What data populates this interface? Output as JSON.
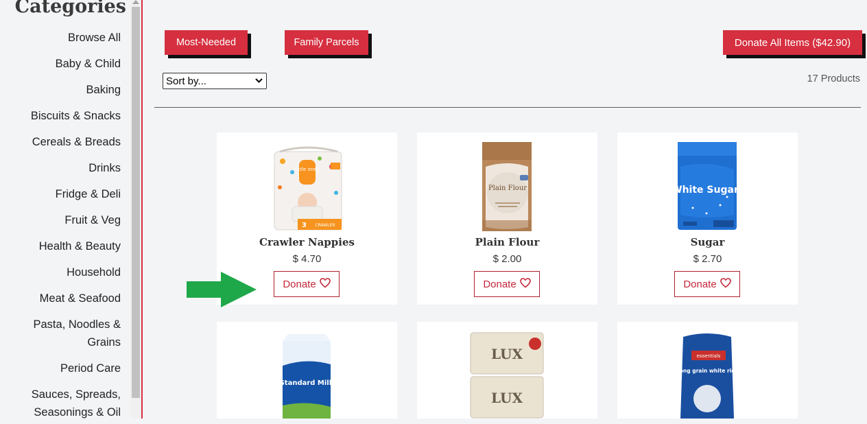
{
  "sidebar": {
    "heading": "Categories",
    "items": [
      {
        "label": "Browse All"
      },
      {
        "label": "Baby & Child"
      },
      {
        "label": "Baking"
      },
      {
        "label": "Biscuits & Snacks"
      },
      {
        "label": "Cereals & Breads"
      },
      {
        "label": "Drinks"
      },
      {
        "label": "Fridge & Deli"
      },
      {
        "label": "Fruit & Veg"
      },
      {
        "label": "Health & Beauty"
      },
      {
        "label": "Household"
      },
      {
        "label": "Meat & Seafood"
      },
      {
        "label": "Pasta, Noodles &",
        "label2": "Grains"
      },
      {
        "label": "Period Care"
      },
      {
        "label": "Sauces, Spreads,",
        "label2": "Seasonings & Oil"
      }
    ]
  },
  "toolbar": {
    "most_needed": "Most-Needed",
    "family_parcels": "Family Parcels",
    "donate_all": "Donate All Items ($42.90)",
    "sort_placeholder": "Sort by...",
    "product_count": "17 Products"
  },
  "products": [
    {
      "name": "Crawler Nappies",
      "price": "$ 4.70",
      "donate": "Donate",
      "icon": "nappies-pack-image"
    },
    {
      "name": "Plain Flour",
      "price": "$ 2.00",
      "donate": "Donate",
      "icon": "flour-bag-image"
    },
    {
      "name": "Sugar",
      "price": "$ 2.70",
      "donate": "Donate",
      "icon": "sugar-bag-image"
    },
    {
      "name": "",
      "price": "",
      "donate": "",
      "icon": "milk-carton-image",
      "image_text": "Standard Milk"
    },
    {
      "name": "",
      "price": "",
      "donate": "",
      "icon": "soap-pack-image",
      "image_text": "LUX"
    },
    {
      "name": "",
      "price": "",
      "donate": "",
      "icon": "rice-bag-image",
      "image_text": "long grain white rice",
      "image_brand": "essentials"
    }
  ],
  "product_images": {
    "nappies": {
      "brand": "little ones",
      "size": "3",
      "type": "CRAWLER"
    },
    "flour": {
      "title": "Plain Flour"
    },
    "sugar": {
      "title": "White Sugar"
    }
  },
  "colors": {
    "accent": "#d62f3f",
    "arrow": "#1fa84a",
    "background": "#f3f4f6"
  }
}
